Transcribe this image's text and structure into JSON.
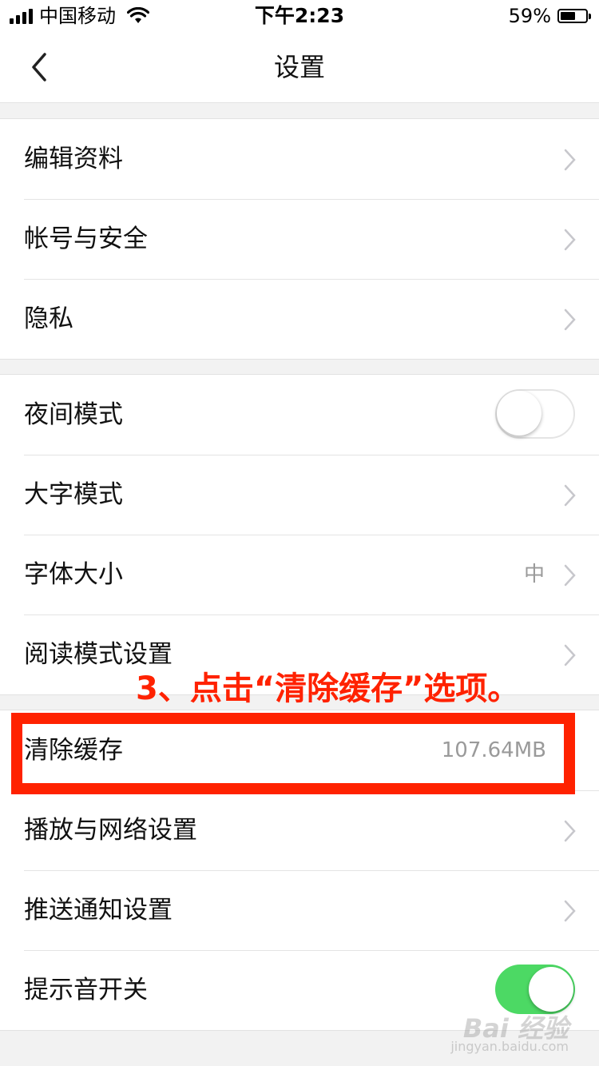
{
  "status_bar": {
    "carrier": "中国移动",
    "time": "下午2:23",
    "battery_percent": "59%",
    "battery_level": 0.59
  },
  "nav": {
    "title": "设置",
    "back_icon": "chevron-left-icon"
  },
  "groups": [
    {
      "items": [
        {
          "label": "编辑资料",
          "accessory": "chevron"
        },
        {
          "label": "帐号与安全",
          "accessory": "chevron"
        },
        {
          "label": "隐私",
          "accessory": "chevron"
        }
      ]
    },
    {
      "items": [
        {
          "label": "夜间模式",
          "accessory": "toggle",
          "toggle_on": false
        },
        {
          "label": "大字模式",
          "accessory": "chevron"
        },
        {
          "label": "字体大小",
          "accessory": "chevron",
          "value": "中"
        },
        {
          "label": "阅读模式设置",
          "accessory": "chevron"
        }
      ]
    },
    {
      "items": [
        {
          "label": "清除缓存",
          "value": "107.64MB"
        },
        {
          "label": "播放与网络设置",
          "accessory": "chevron"
        },
        {
          "label": "推送通知设置",
          "accessory": "chevron"
        },
        {
          "label": "提示音开关",
          "accessory": "toggle",
          "toggle_on": true
        }
      ]
    }
  ],
  "annotation": {
    "text": "3、点击“清除缓存”选项。",
    "color": "#ff2200"
  },
  "watermark": {
    "text": "Bai 经验",
    "sub": "jingyan.baidu.com"
  },
  "colors": {
    "toggle_on": "#4cd964",
    "chevron": "#c7c7cc",
    "value_text": "#9a9a9a"
  }
}
